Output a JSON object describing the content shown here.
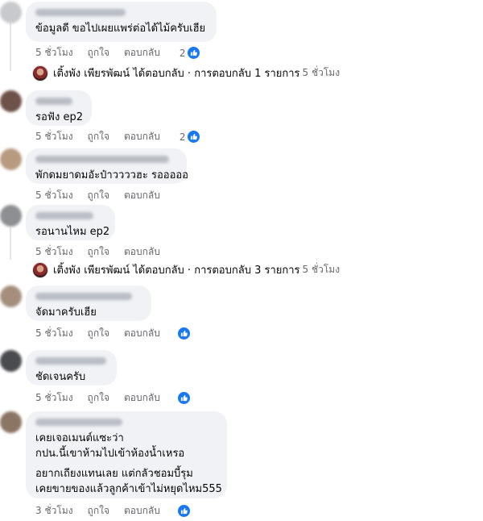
{
  "comments": [
    {
      "lines": [
        "ข้อมูลดี ขอไปเผยแพร่ต่อได้ไม้ครับเฮีย"
      ],
      "time": "5 ชั่วโมง",
      "like": "ถูกใจ",
      "reply": "ตอบกลับ",
      "reactions": "2"
    },
    {
      "lines": [
        "รอฟัง ep2"
      ],
      "time": "5 ชั่วโมง",
      "like": "ถูกใจ",
      "reply": "ตอบกลับ",
      "reactions": "2"
    },
    {
      "lines": [
        "พักดมยาดมอัะป๋าววววฮะ รอออออ"
      ],
      "time": "5 ชั่วโมง",
      "like": "ถูกใจ",
      "reply": "ตอบกลับ",
      "reactions": ""
    },
    {
      "lines": [
        "รอนานไหม ep2"
      ],
      "time": "5 ชั่วโมง",
      "like": "ถูกใจ",
      "reply": "ตอบกลับ",
      "reactions": ""
    },
    {
      "lines": [
        "จัดมาครับเฮีย"
      ],
      "time": "5 ชั่วโมง",
      "like": "ถูกใจ",
      "reply": "ตอบกลับ",
      "reactions": ""
    },
    {
      "lines": [
        "ชัดเจนครับ"
      ],
      "time": "5 ชั่วโมง",
      "like": "ถูกใจ",
      "reply": "ตอบกลับ",
      "reactions": ""
    },
    {
      "lines": [
        "เคยเจอเมนต์แซะว่า",
        "กปน.นี้เขาห้ามไปเข้าห้องน้ำเหรอ",
        "อยากเถียงแทนเลย แต่กลัวชอมบี้รุม",
        "เคยขายของแล้วลูกค้าเข้าไม่หยุดไหม555"
      ],
      "time": "3 ชั่วโมง",
      "like": "ถูกใจ",
      "reply": "ตอบกลับ",
      "reactions": ""
    }
  ],
  "reply_summaries": [
    {
      "text": "เติ้งพัง เพียรพัฒน์ ได้ตอบกลับ · การตอบกลับ 1 รายการ",
      "time": "5 ชั่วโมง"
    },
    {
      "text": "เติ้งพัง เพียรพัฒน์ ได้ตอบกลับ · การตอบกลับ 3 รายการ",
      "time": "5 ชั่วโมง"
    }
  ],
  "icons": {
    "reaction": "like-icon",
    "colors": {
      "like": "#1877f2",
      "meta": "#65676b",
      "bubble": "#f0f2f5"
    }
  }
}
